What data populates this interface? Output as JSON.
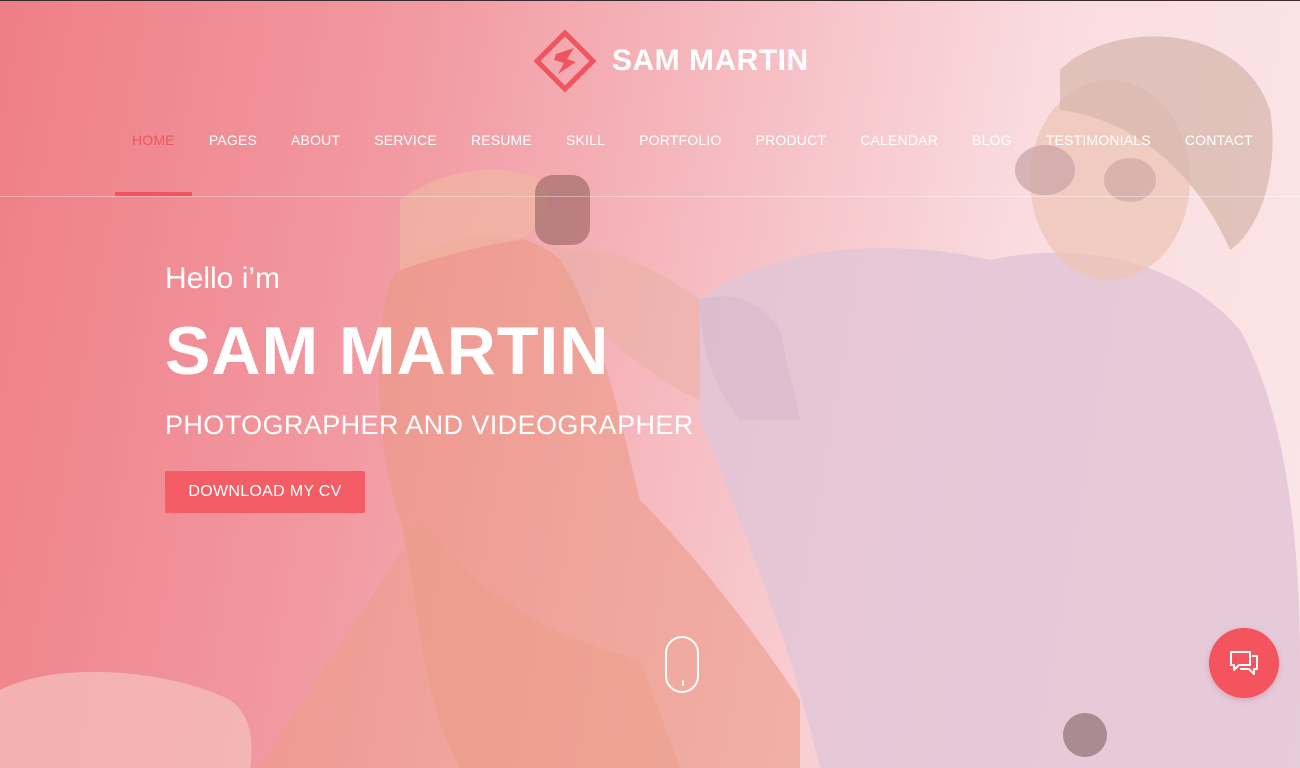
{
  "brand": {
    "name": "SAM MARTIN",
    "accent": "#f0545e"
  },
  "nav": {
    "items": [
      {
        "label": "HOME",
        "active": true
      },
      {
        "label": "PAGES",
        "active": false
      },
      {
        "label": "ABOUT",
        "active": false
      },
      {
        "label": "SERVICE",
        "active": false
      },
      {
        "label": "RESUME",
        "active": false
      },
      {
        "label": "SKILL",
        "active": false
      },
      {
        "label": "PORTFOLIO",
        "active": false
      },
      {
        "label": "PRODUCT",
        "active": false
      },
      {
        "label": "CALENDAR",
        "active": false
      },
      {
        "label": "BLOG",
        "active": false
      },
      {
        "label": "TESTIMONIALS",
        "active": false
      },
      {
        "label": "CONTACT",
        "active": false
      }
    ]
  },
  "hero": {
    "greeting": "Hello i’m",
    "name": "SAM MARTIN",
    "role": "PHOTOGRAPHER AND VIDEOGRAPHER",
    "cta_label": "DOWNLOAD MY CV"
  },
  "icons": {
    "logo": "diamond-logo-icon",
    "scroll": "mouse-scroll-icon",
    "chat": "chat-bubbles-icon"
  },
  "colors": {
    "overlay_left": "#ef7e86",
    "overlay_right": "#fbe6e8",
    "button": "#f45d66",
    "text": "#ffffff"
  }
}
